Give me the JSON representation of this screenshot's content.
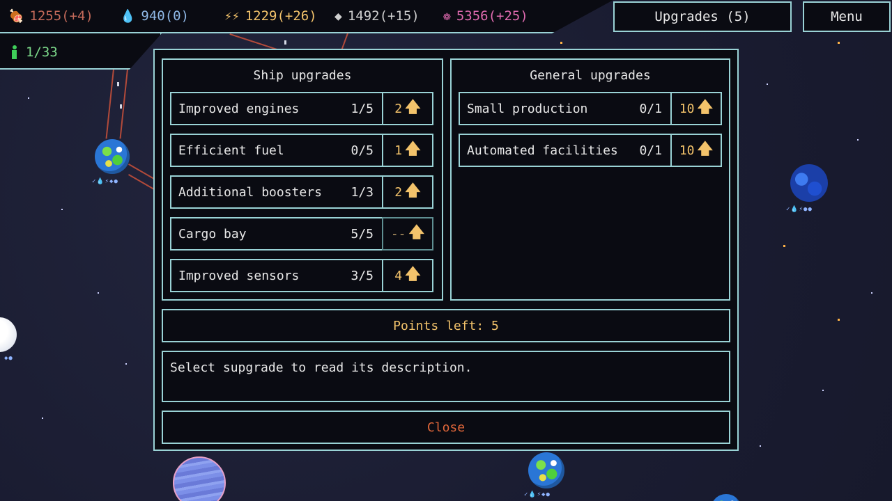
{
  "resources": [
    {
      "icon": "meat-icon",
      "glyph": "🍖",
      "text": "1255(+4)",
      "color": "#c46a5a"
    },
    {
      "icon": "water-drop-icon",
      "glyph": "💧",
      "text": "940(0)",
      "color": "#8fb8e6"
    },
    {
      "icon": "energy-icon",
      "glyph": "⚡⚡",
      "text": "1229(+26)",
      "color": "#f3c36b"
    },
    {
      "icon": "metal-icon",
      "glyph": "◆",
      "text": "1492(+15)",
      "color": "#cfcfcf"
    },
    {
      "icon": "brain-icon",
      "glyph": "❁",
      "text": "5356(+25)",
      "color": "#e06bb0"
    }
  ],
  "population": {
    "text": "1/33"
  },
  "top_buttons": {
    "upgrades": "Upgrades (5)",
    "menu": "Menu"
  },
  "ship_upgrades": {
    "title": "Ship upgrades",
    "items": [
      {
        "name": "Improved engines",
        "level": "1/5",
        "cost": "2",
        "disabled": false
      },
      {
        "name": "Efficient fuel",
        "level": "0/5",
        "cost": "1",
        "disabled": false
      },
      {
        "name": "Additional boosters",
        "level": "1/3",
        "cost": "2",
        "disabled": false
      },
      {
        "name": "Cargo bay",
        "level": "5/5",
        "cost": "--",
        "disabled": true
      },
      {
        "name": "Improved sensors",
        "level": "3/5",
        "cost": "4",
        "disabled": false
      }
    ]
  },
  "general_upgrades": {
    "title": "General upgrades",
    "items": [
      {
        "name": "Small production",
        "level": "0/1",
        "cost": "10",
        "disabled": false
      },
      {
        "name": "Automated facilities",
        "level": "0/1",
        "cost": "10",
        "disabled": false
      }
    ]
  },
  "points_left": "Points left: 5",
  "description": "Select supgrade to read its description.",
  "close_label": "Close"
}
